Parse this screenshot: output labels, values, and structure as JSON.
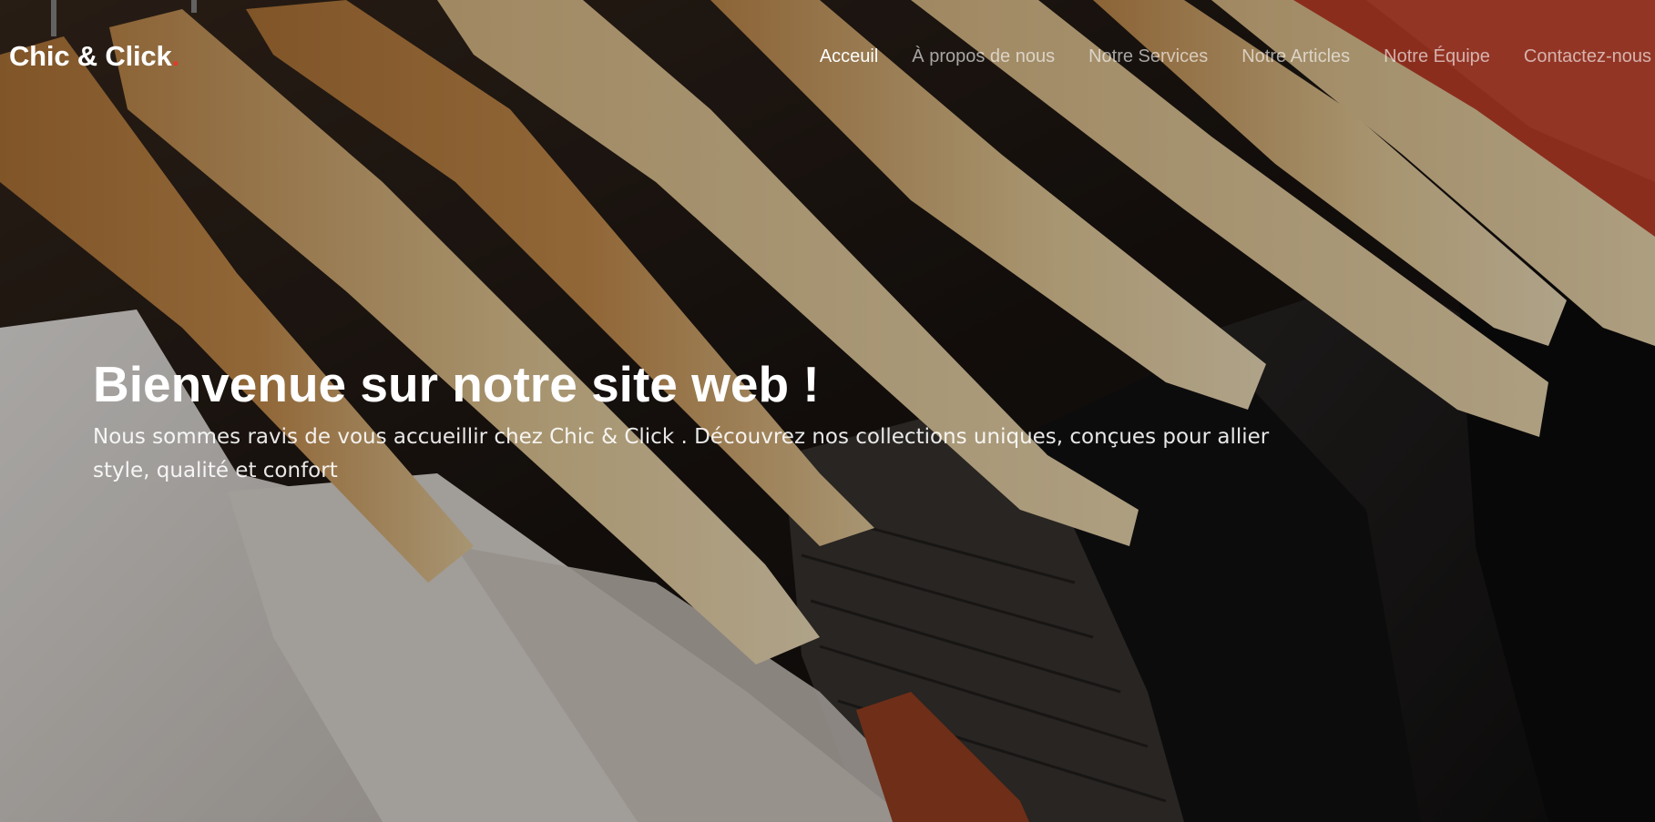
{
  "brand": {
    "name": "Chic & Click",
    "dot": ".",
    "accent_color": "#e03b2c"
  },
  "nav": {
    "items": [
      {
        "label": "Acceuil",
        "active": true
      },
      {
        "label": "À propos de nous",
        "active": false
      },
      {
        "label": "Notre Services",
        "active": false
      },
      {
        "label": "Notre Articles",
        "active": false
      },
      {
        "label": "Notre Équipe",
        "active": false
      },
      {
        "label": "Contactez-nous",
        "active": false
      }
    ]
  },
  "hero": {
    "title": "Bienvenue sur notre site web !",
    "subtitle": "Nous sommes ravis de vous accueillir chez Chic & Click . Découvrez nos collections uniques, conçues pour allier style, qualité et confort",
    "background": "clothing-rack-photo"
  }
}
